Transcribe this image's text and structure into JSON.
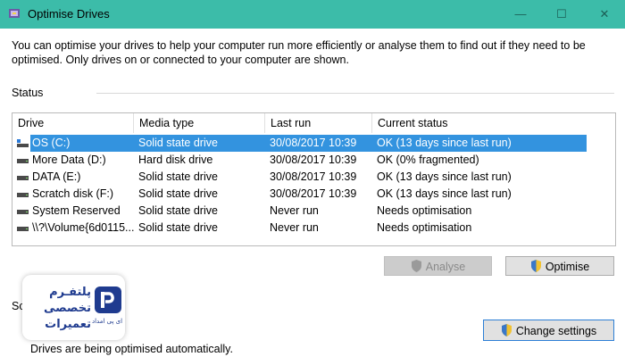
{
  "window": {
    "title": "Optimise Drives",
    "minimize": "—",
    "maximize": "☐",
    "close": "✕"
  },
  "description": "You can optimise your drives to help your computer run more efficiently or analyse them to find out if they need to be optimised. Only drives on or connected to your computer are shown.",
  "status_section": {
    "label": "Status",
    "columns": [
      "Drive",
      "Media type",
      "Last run",
      "Current status"
    ],
    "rows": [
      {
        "drive": "OS (C:)",
        "media": "Solid state drive",
        "last_run": "30/08/2017 10:39",
        "status": "OK (13 days since last run)",
        "icon": "os-drive-icon",
        "selected": true
      },
      {
        "drive": "More Data (D:)",
        "media": "Hard disk drive",
        "last_run": "30/08/2017 10:39",
        "status": "OK (0% fragmented)",
        "icon": "drive-icon"
      },
      {
        "drive": "DATA (E:)",
        "media": "Solid state drive",
        "last_run": "30/08/2017 10:39",
        "status": "OK (13 days since last run)",
        "icon": "drive-icon"
      },
      {
        "drive": "Scratch disk (F:)",
        "media": "Solid state drive",
        "last_run": "30/08/2017 10:39",
        "status": "OK (13 days since last run)",
        "icon": "drive-icon"
      },
      {
        "drive": "System Reserved",
        "media": "Solid state drive",
        "last_run": "Never run",
        "status": "Needs optimisation",
        "icon": "drive-icon"
      },
      {
        "drive": "\\\\?\\Volume{6d0115...",
        "media": "Solid state drive",
        "last_run": "Never run",
        "status": "Needs optimisation",
        "icon": "drive-icon"
      }
    ]
  },
  "buttons": {
    "analyse": "Analyse",
    "optimise": "Optimise",
    "change_settings": "Change settings"
  },
  "scheduled_section": {
    "label": "Sc",
    "footer": "Drives are being optimised automatically."
  },
  "logo": {
    "line1": "پلتفـرم",
    "line2": "تخصصی",
    "line3": "تعمیرات",
    "subtitle": "ای پی امداد"
  },
  "colors": {
    "titlebar": "#3cbca9",
    "selection": "#3393df",
    "logo": "#1f3b8f"
  }
}
